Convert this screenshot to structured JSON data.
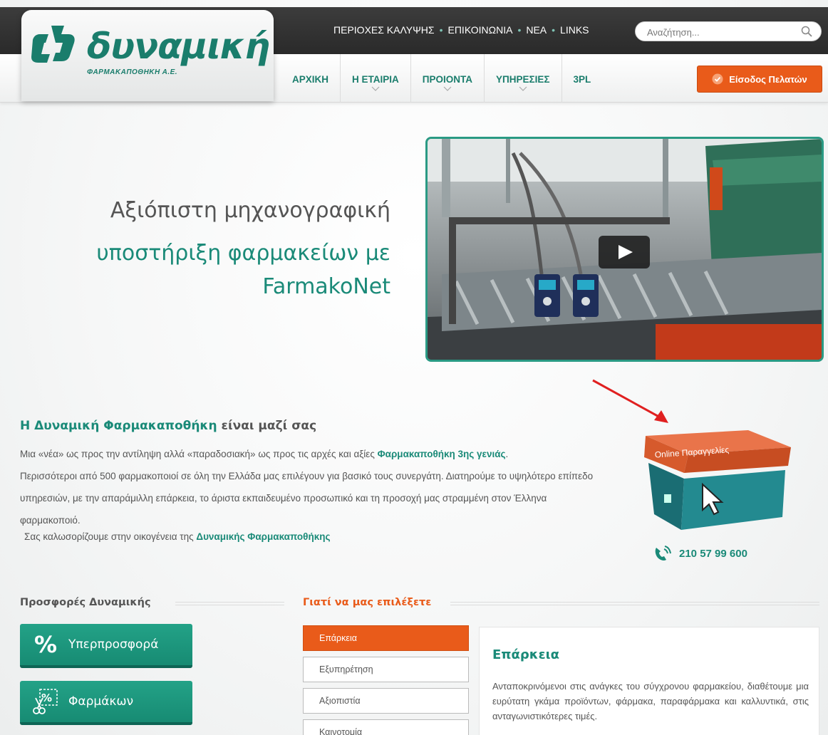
{
  "brand": {
    "name": "δυναμική",
    "subtitle": "ΦΑΡΜΑΚΑΠΟΘΗΚΗ Α.Ε.",
    "color": "#1a7d6c"
  },
  "topnav": {
    "items": [
      "ΠΕΡΙΟΧΕΣ ΚΑΛΥΨΗΣ",
      "ΕΠΙΚΟΙΝΩΝΙΑ",
      "ΝΕΑ",
      "LINKS"
    ]
  },
  "search": {
    "placeholder": "Αναζήτηση...",
    "value": ""
  },
  "mainnav": {
    "items": [
      {
        "label": "ΑΡΧΙΚΗ",
        "dropdown": false
      },
      {
        "label": "Η ΕΤΑΙΡΙΑ",
        "dropdown": true
      },
      {
        "label": "ΠΡΟΙΟΝΤΑ",
        "dropdown": true
      },
      {
        "label": "ΥΠΗΡΕΣΙΕΣ",
        "dropdown": true
      },
      {
        "label": "3PL",
        "dropdown": false
      }
    ]
  },
  "login": {
    "label": "Είσοδος Πελατών",
    "color": "#e95b1a"
  },
  "hero": {
    "line1": "Αξιόπιστη μηχανογραφική",
    "line2": "υποστήριξη φαρμακείων με",
    "line3": "FarmakoNet"
  },
  "intro": {
    "title_green": "Η Δυναμική Φαρμακαποθήκη",
    "title_rest": " είναι μαζί σας",
    "p1_a": "Μια «νέα» ως προς την αντίληψη αλλά «παραδοσιακή» ως προς τις αρχές και αξίες ",
    "p1_b": "Φαρμακαποθήκη 3ης γενιάς",
    "p1_c": ".",
    "p2": "Περισσότεροι από 500 φαρμακοποιοί σε όλη την Ελλάδα  μας επιλέγουν για βασικό τους συνεργάτη. Διατηρούμε το υψηλότερο επίπεδο υπηρεσιών, με την απαράμιλλη  επάρκεια, το άριστα εκπαιδευμένο προσωπικό και τη προσοχή μας στραμμένη στον Έλληνα φαρμακοποιό.",
    "welcome_a": "Σας καλωσορίζουμε στην οικογένεια της ",
    "welcome_b": "Δυναμικής Φαρμακαποθήκης"
  },
  "order": {
    "label": "Online Παραγγελίες"
  },
  "phone": {
    "number": "210 57 99 600"
  },
  "offers": {
    "title": "Προσφορές Δυναμικής",
    "buttons": [
      "Υπερπροσφορά",
      "Φαρμάκων"
    ]
  },
  "why": {
    "title": "Γιατί να μας επιλέξετε",
    "tabs": [
      "Επάρκεια",
      "Εξυπηρέτηση",
      "Αξιοπιστία",
      "Καινοτομία"
    ],
    "active_tab": "Επάρκεια",
    "panel_title": "Επάρκεια",
    "panel_body": "Ανταποκρινόμενοι στις ανάγκες του σύγχρονου φαρμακείου, διαθέτουμε μια ευρύτατη γκάμα προϊόντων, φάρμακα, παραφάρμακα και καλλυντικά, στις ανταγωνιστικότερες τιμές."
  },
  "colors": {
    "accent": "#1a8a78",
    "orange": "#e95b1a",
    "dark": "#333333"
  }
}
